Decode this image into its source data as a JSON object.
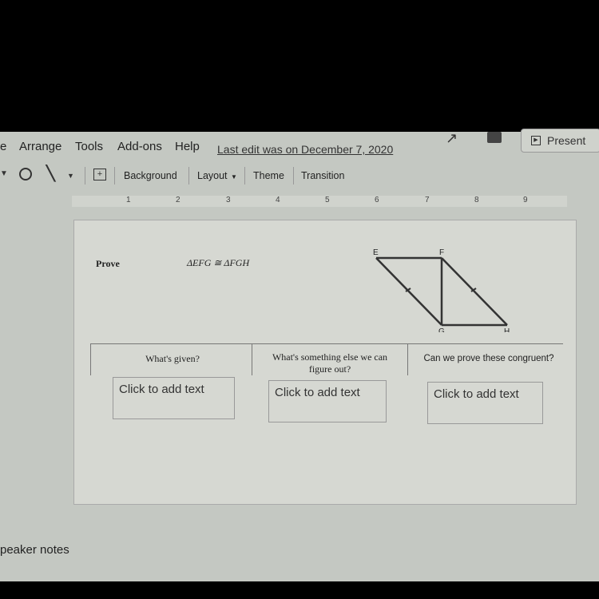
{
  "menu": {
    "items": [
      "e",
      "Arrange",
      "Tools",
      "Add-ons",
      "Help"
    ],
    "last_edit": "Last edit was on December 7, 2020",
    "present_label": "Present"
  },
  "toolbar": {
    "background": "Background",
    "layout": "Layout",
    "theme": "Theme",
    "transition": "Transition"
  },
  "ruler": {
    "ticks": [
      "1",
      "2",
      "3",
      "4",
      "5",
      "6",
      "7",
      "8",
      "9"
    ]
  },
  "slide": {
    "prove_label": "Prove",
    "statement": "ΔEFG ≅ ΔFGH",
    "diagram": {
      "points": [
        "E",
        "F",
        "G",
        "H"
      ]
    },
    "columns": [
      {
        "header": "What's given?",
        "placeholder": "Click to add text"
      },
      {
        "header": "What's something else we can figure out?",
        "placeholder": "Click to add text"
      },
      {
        "header": "Can we prove these congruent?",
        "placeholder": "Click to add text"
      }
    ]
  },
  "speaker_notes": "peaker notes"
}
